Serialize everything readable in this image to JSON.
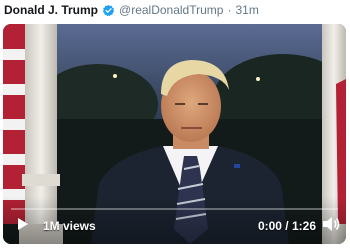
{
  "tweet": {
    "display_name": "Donald J. Trump",
    "handle": "@realDonaldTrump",
    "separator": "·",
    "time": "31m",
    "verified_icon": "verified-badge-icon",
    "accent_color": "#1da1f2"
  },
  "video": {
    "views": "1M views",
    "timecode": "0:00 / 1:26",
    "progress_fraction": 0.0,
    "play_icon": "play-icon",
    "volume_icon": "volume-icon"
  }
}
